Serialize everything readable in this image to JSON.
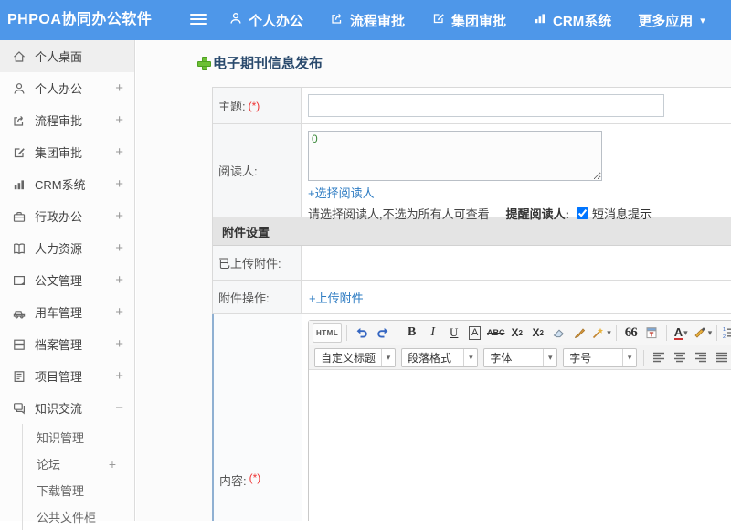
{
  "header": {
    "logo": "PHPOA协同办公软件",
    "nav": [
      {
        "label": "个人办公",
        "icon": "person-icon"
      },
      {
        "label": "流程审批",
        "icon": "workflow-icon"
      },
      {
        "label": "集团审批",
        "icon": "edit-icon"
      },
      {
        "label": "CRM系统",
        "icon": "chart-icon"
      },
      {
        "label": "更多应用",
        "icon": "caret-down-icon"
      }
    ],
    "caret": "▾"
  },
  "sidebar": {
    "items": [
      {
        "label": "个人桌面",
        "icon": "home-icon",
        "expand": "",
        "active": true
      },
      {
        "label": "个人办公",
        "icon": "person-icon",
        "expand": "+"
      },
      {
        "label": "流程审批",
        "icon": "workflow-icon",
        "expand": "+"
      },
      {
        "label": "集团审批",
        "icon": "edit-icon",
        "expand": "+"
      },
      {
        "label": "CRM系统",
        "icon": "chart-icon",
        "expand": "+"
      },
      {
        "label": "行政办公",
        "icon": "briefcase-icon",
        "expand": "+"
      },
      {
        "label": "人力资源",
        "icon": "book-icon",
        "expand": "+"
      },
      {
        "label": "公文管理",
        "icon": "document-icon",
        "expand": "+"
      },
      {
        "label": "用车管理",
        "icon": "car-icon",
        "expand": "+"
      },
      {
        "label": "档案管理",
        "icon": "archive-icon",
        "expand": "+"
      },
      {
        "label": "项目管理",
        "icon": "project-icon",
        "expand": "+"
      },
      {
        "label": "知识交流",
        "icon": "chat-icon",
        "expand": "−"
      }
    ],
    "subitems": [
      {
        "label": "知识管理",
        "expand": ""
      },
      {
        "label": "论坛",
        "expand": "+"
      },
      {
        "label": "下载管理",
        "expand": ""
      },
      {
        "label": "公共文件柜",
        "expand": ""
      }
    ]
  },
  "main": {
    "page_title": "电子期刊信息发布",
    "form": {
      "subject_label": "主题:",
      "required_mark": "(*)",
      "readers_label": "阅读人:",
      "readers_value": "0",
      "select_readers_link": "+选择阅读人",
      "readers_hint": "请选择阅读人,不选为所有人可查看",
      "remind_label": "提醒阅读人:",
      "sms_label": "短消息提示",
      "sms_checked": true,
      "attachment_section": "附件设置",
      "uploaded_label": "已上传附件:",
      "ops_label": "附件操作:",
      "upload_link": "+上传附件",
      "content_label": "内容:"
    },
    "editor": {
      "html_button": "HTML",
      "bold": "B",
      "italic": "I",
      "underline": "U",
      "font_box": "A",
      "strike": "ABC",
      "sup_base": "X",
      "sup_exp": "2",
      "sub_base": "X",
      "sub_idx": "2",
      "quote": "66",
      "font_color": "A",
      "heading_select": "自定义标题",
      "paragraph_select": "段落格式",
      "font_select": "字体",
      "size_select": "字号"
    },
    "colors": {
      "topbar_blue": "#4e97e9",
      "link_blue": "#2e7cc3",
      "required_red": "#e33333",
      "title_navy": "#2a4a6d",
      "reader_value_green": "#3c8a3c"
    }
  }
}
